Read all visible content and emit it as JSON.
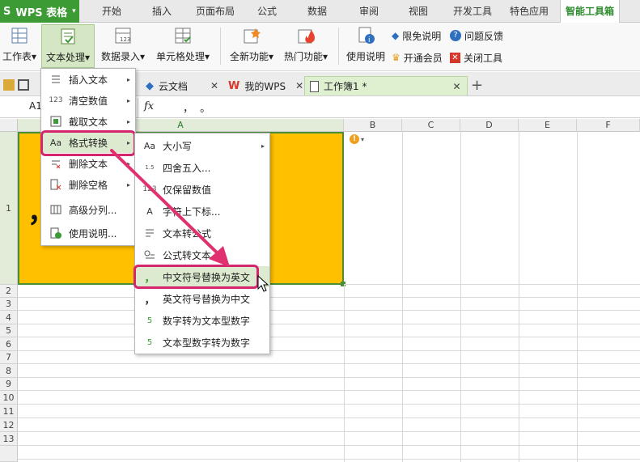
{
  "app": {
    "logo_prefix": "S",
    "name": "WPS 表格",
    "dropdown": "▾"
  },
  "ribbon_tabs": [
    "开始",
    "插入",
    "页面布局",
    "公式",
    "数据",
    "审阅",
    "视图",
    "开发工具",
    "特色应用",
    "智能工具箱"
  ],
  "ribbon": {
    "btn_worksheet": "工作表",
    "btn_text": "文本处理",
    "btn_data_entry": "数据录入",
    "btn_cell": "单元格处理",
    "btn_new": "全新功能",
    "btn_hot": "热门功能",
    "btn_help": "使用说明",
    "disclaimer": "限免说明",
    "feedback": "问题反馈",
    "vip": "开通会员",
    "close_tool": "关闭工具",
    "caret": "▾"
  },
  "doc_tabs": {
    "cloud": "云文档",
    "mywps": "我的WPS",
    "book": "工作簿1 *",
    "add": "+",
    "close": "✕"
  },
  "formula_bar": {
    "cell_ref": "A1",
    "fx": "fx",
    "content": "，  。"
  },
  "columns": [
    "A",
    "B",
    "C",
    "D",
    "E",
    "F"
  ],
  "rows": [
    "1",
    "2",
    "3",
    "4",
    "5",
    "6",
    "7",
    "8",
    "9",
    "10",
    "11",
    "12",
    "13"
  ],
  "cell_a1_display": "，",
  "menu1": [
    {
      "label": "插入文本",
      "icon": "insert-text-icon",
      "arrow": "▸"
    },
    {
      "label": "清空数值",
      "icon": "clear-values-icon",
      "arrow": "▸",
      "icon_text": "123"
    },
    {
      "label": "截取文本",
      "icon": "extract-text-icon",
      "arrow": "▸"
    },
    {
      "label": "格式转换",
      "icon": "format-convert-icon",
      "arrow": "▸",
      "icon_text": "Aa"
    },
    {
      "label": "删除文本",
      "icon": "delete-text-icon",
      "arrow": "▸"
    },
    {
      "label": "删除空格",
      "icon": "delete-space-icon",
      "arrow": "▸"
    },
    {
      "label": "高级分列...",
      "icon": "split-column-icon",
      "arrow": ""
    },
    {
      "label": "使用说明...",
      "icon": "help-doc-icon",
      "arrow": ""
    }
  ],
  "menu2": [
    {
      "label": "大小写",
      "icon": "case-icon",
      "arrow": "▸",
      "icon_text": "Aa"
    },
    {
      "label": "四舍五入...",
      "icon": "round-icon",
      "arrow": "",
      "icon_text": "1.5"
    },
    {
      "label": "仅保留数值",
      "icon": "keep-number-icon",
      "arrow": "",
      "icon_text": "123"
    },
    {
      "label": "字符上下标...",
      "icon": "subscript-icon",
      "arrow": "",
      "icon_text": "A"
    },
    {
      "label": "文本转公式",
      "icon": "text-to-formula-icon",
      "arrow": ""
    },
    {
      "label": "公式转文本",
      "icon": "formula-to-text-icon",
      "arrow": ""
    },
    {
      "label": "中文符号替换为英文",
      "icon": "cn-to-en-punct-icon",
      "arrow": "",
      "icon_text": "，"
    },
    {
      "label": "英文符号替换为中文",
      "icon": "en-to-cn-punct-icon",
      "arrow": "",
      "icon_text": "，"
    },
    {
      "label": "数字转为文本型数字",
      "icon": "num-to-text-icon",
      "arrow": "",
      "icon_text": "5"
    },
    {
      "label": "文本型数字转为数字",
      "icon": "text-to-num-icon",
      "arrow": "",
      "icon_text": "5"
    }
  ],
  "colors": {
    "accent": "#3d9b35",
    "highlight": "#d3266d",
    "cell_fill": "#ffc000",
    "selection": "#4a8f35"
  }
}
